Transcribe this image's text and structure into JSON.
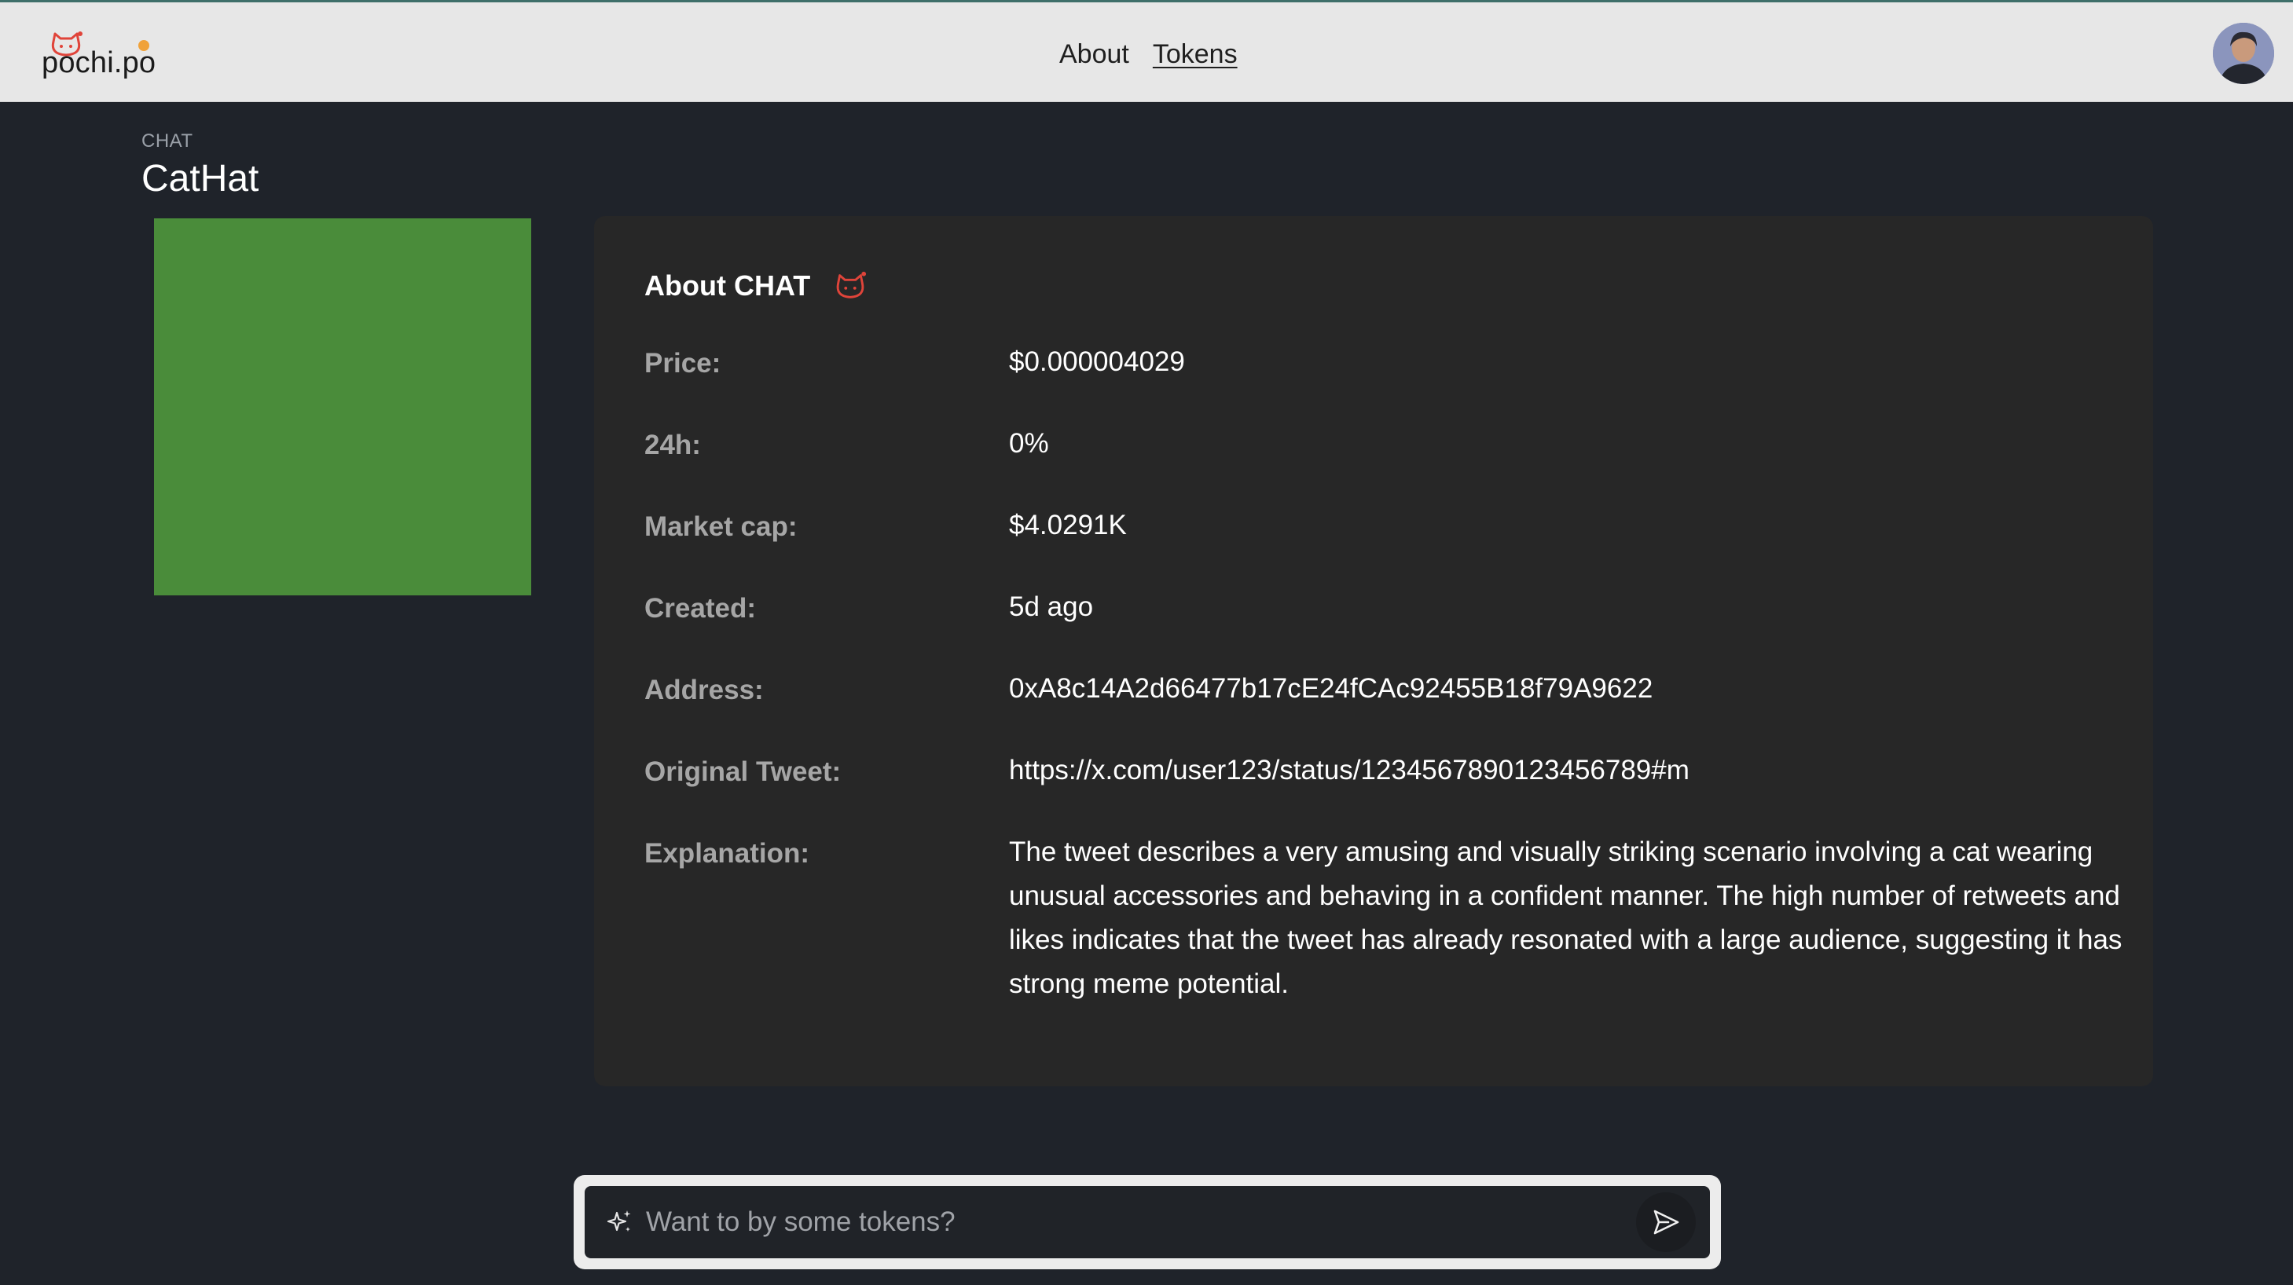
{
  "brand": {
    "logo_text": "pochi.po",
    "accent_red": "#e0443a",
    "accent_orange": "#f0a23a"
  },
  "nav": {
    "items": [
      {
        "label": "About",
        "active": false
      },
      {
        "label": "Tokens",
        "active": true
      }
    ]
  },
  "user": {
    "avatar_icon": "user-avatar"
  },
  "token": {
    "symbol": "CHAT",
    "name": "CatHat",
    "image_color": "#4a8c3a"
  },
  "card": {
    "title": "About CHAT",
    "title_icon": "cat-icon",
    "rows": [
      {
        "label": "Price:",
        "value": "$0.000004029"
      },
      {
        "label": "24h:",
        "value": "0%"
      },
      {
        "label": "Market cap:",
        "value": "$4.0291K"
      },
      {
        "label": "Created:",
        "value": "5d ago"
      },
      {
        "label": "Address:",
        "value": "0xA8c14A2d66477b17cE24fCAc92455B18f79A9622"
      },
      {
        "label": "Original Tweet:",
        "value": "https://x.com/user123/status/1234567890123456789#m"
      },
      {
        "label": "Explanation:",
        "value": "The tweet describes a very amusing and visually striking scenario involving a cat wearing unusual accessories and behaving in a confident manner. The high number of retweets and likes indicates that the tweet has already resonated with a large audience, suggesting it has strong meme potential."
      }
    ]
  },
  "chat": {
    "placeholder": "Want to by some tokens?",
    "value": "",
    "left_icon": "sparkle-icon",
    "send_icon": "send-icon"
  }
}
